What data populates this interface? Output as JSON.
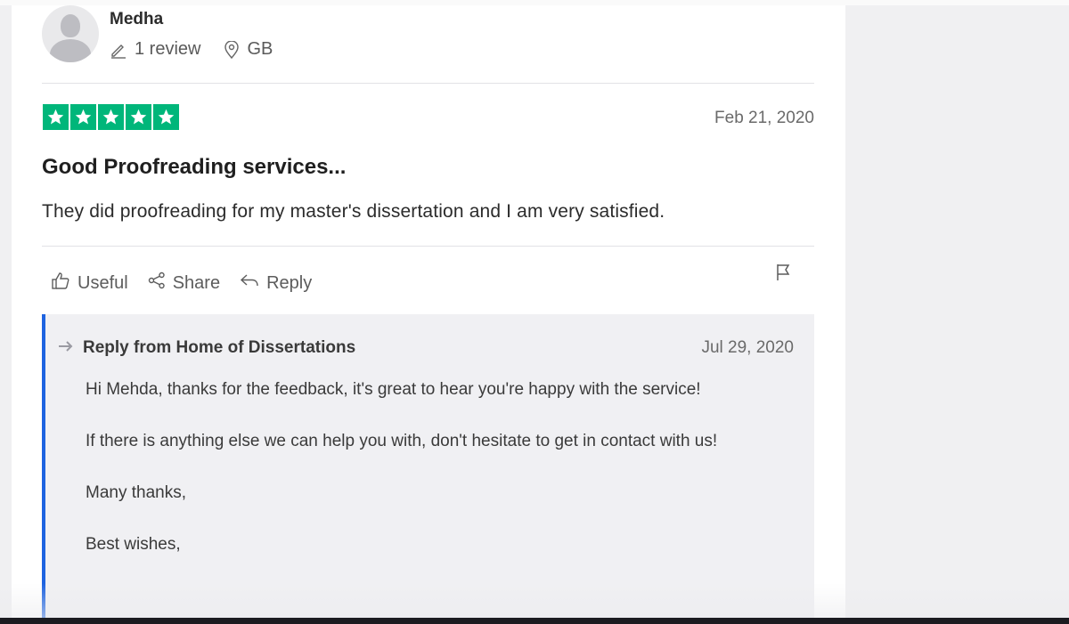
{
  "reviewer": {
    "name": "Medha",
    "review_count": "1 review",
    "country": "GB"
  },
  "review": {
    "rating_stars": 5,
    "date": "Feb 21, 2020",
    "title": "Good Proofreading services...",
    "text": "They did proofreading for my master's dissertation and I am very satisfied.",
    "star_color": "#00b67a"
  },
  "actions": {
    "useful": "Useful",
    "share": "Share",
    "reply": "Reply"
  },
  "reply": {
    "heading": "Reply from Home of Dissertations",
    "date": "Jul 29, 2020",
    "paragraphs": [
      "Hi Mehda, thanks for the feedback, it's great to hear you're happy with the service!",
      "If there is anything else we can help you with, don't hesitate to get in contact with us!",
      "Many thanks,",
      "Best wishes,"
    ],
    "accent_color": "#1e63e0"
  }
}
